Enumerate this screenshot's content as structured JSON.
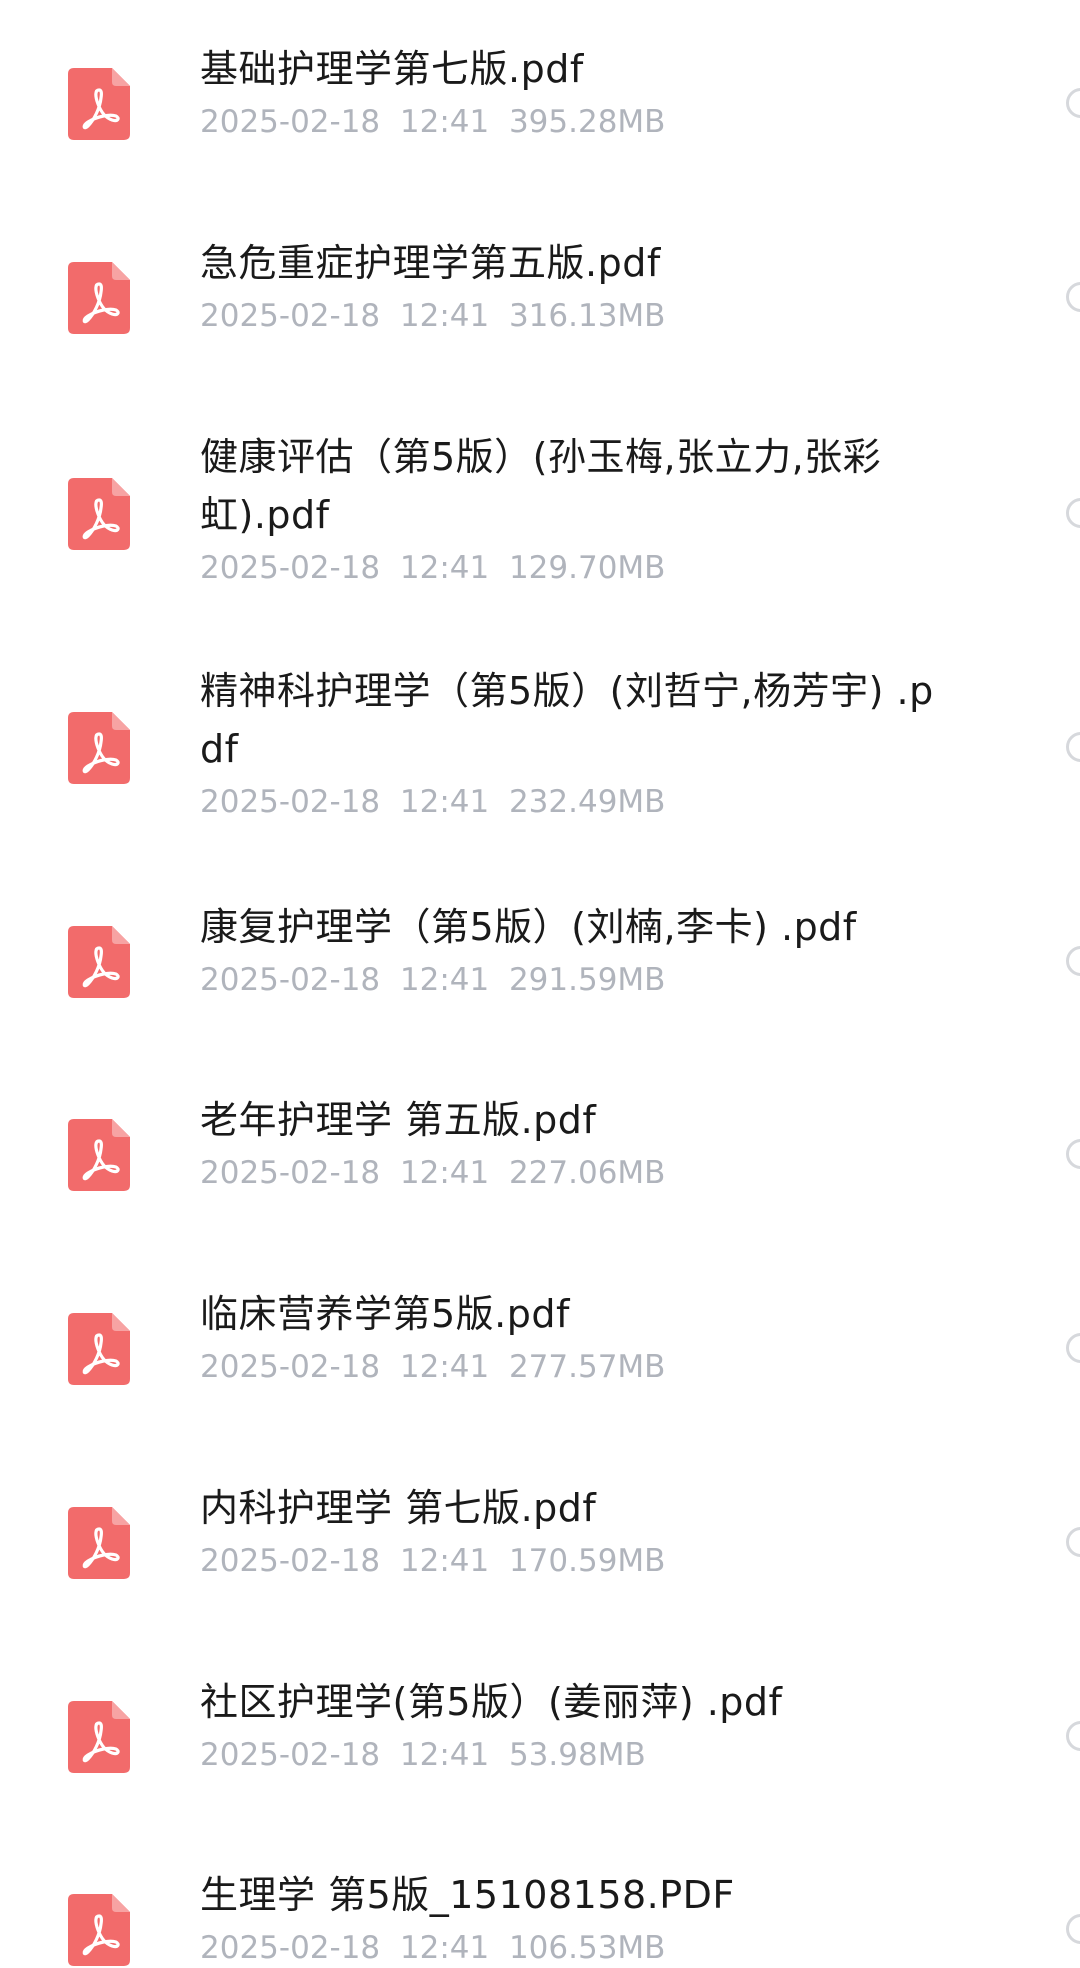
{
  "files": [
    {
      "name": "基础护理学第七版.pdf",
      "date": "2025-02-18",
      "time": "12:41",
      "size": "395.28MB"
    },
    {
      "name": "急危重症护理学第五版.pdf",
      "date": "2025-02-18",
      "time": "12:41",
      "size": "316.13MB"
    },
    {
      "name": "健康评估（第5版）(孙玉梅,张立力,张彩虹).pdf",
      "date": "2025-02-18",
      "time": "12:41",
      "size": "129.70MB"
    },
    {
      "name": "精神科护理学（第5版）(刘哲宁,杨芳宇) .pdf",
      "date": "2025-02-18",
      "time": "12:41",
      "size": "232.49MB"
    },
    {
      "name": "康复护理学（第5版）(刘楠,李卡) .pdf",
      "date": "2025-02-18",
      "time": "12:41",
      "size": "291.59MB"
    },
    {
      "name": "老年护理学 第五版.pdf",
      "date": "2025-02-18",
      "time": "12:41",
      "size": "227.06MB"
    },
    {
      "name": "临床营养学第5版.pdf",
      "date": "2025-02-18",
      "time": "12:41",
      "size": "277.57MB"
    },
    {
      "name": "内科护理学  第七版.pdf",
      "date": "2025-02-18",
      "time": "12:41",
      "size": "170.59MB"
    },
    {
      "name": "社区护理学(第5版）(姜丽萍) .pdf",
      "date": "2025-02-18",
      "time": "12:41",
      "size": "53.98MB"
    },
    {
      "name": "生理学  第5版_15108158.PDF",
      "date": "2025-02-18",
      "time": "12:41",
      "size": "106.53MB"
    }
  ],
  "icon": "pdf-file-icon",
  "colors": {
    "pdf_icon": "#f26b6b",
    "name_text": "#1a1a1a",
    "meta_text": "#b0b4bc",
    "radio_border": "#d6d8dc"
  }
}
